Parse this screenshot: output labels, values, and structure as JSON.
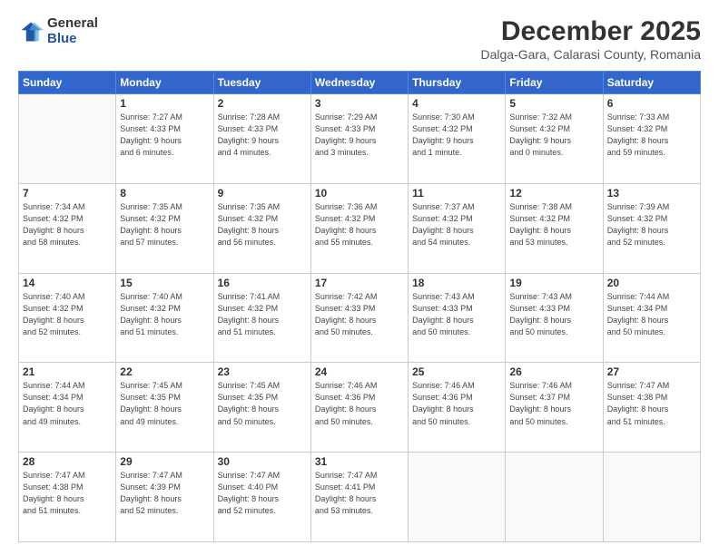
{
  "logo": {
    "general": "General",
    "blue": "Blue"
  },
  "header": {
    "title": "December 2025",
    "subtitle": "Dalga-Gara, Calarasi County, Romania"
  },
  "calendar": {
    "days_of_week": [
      "Sunday",
      "Monday",
      "Tuesday",
      "Wednesday",
      "Thursday",
      "Friday",
      "Saturday"
    ],
    "weeks": [
      [
        {
          "day": "",
          "info": ""
        },
        {
          "day": "1",
          "info": "Sunrise: 7:27 AM\nSunset: 4:33 PM\nDaylight: 9 hours\nand 6 minutes."
        },
        {
          "day": "2",
          "info": "Sunrise: 7:28 AM\nSunset: 4:33 PM\nDaylight: 9 hours\nand 4 minutes."
        },
        {
          "day": "3",
          "info": "Sunrise: 7:29 AM\nSunset: 4:33 PM\nDaylight: 9 hours\nand 3 minutes."
        },
        {
          "day": "4",
          "info": "Sunrise: 7:30 AM\nSunset: 4:32 PM\nDaylight: 9 hours\nand 1 minute."
        },
        {
          "day": "5",
          "info": "Sunrise: 7:32 AM\nSunset: 4:32 PM\nDaylight: 9 hours\nand 0 minutes."
        },
        {
          "day": "6",
          "info": "Sunrise: 7:33 AM\nSunset: 4:32 PM\nDaylight: 8 hours\nand 59 minutes."
        }
      ],
      [
        {
          "day": "7",
          "info": "Sunrise: 7:34 AM\nSunset: 4:32 PM\nDaylight: 8 hours\nand 58 minutes."
        },
        {
          "day": "8",
          "info": "Sunrise: 7:35 AM\nSunset: 4:32 PM\nDaylight: 8 hours\nand 57 minutes."
        },
        {
          "day": "9",
          "info": "Sunrise: 7:35 AM\nSunset: 4:32 PM\nDaylight: 8 hours\nand 56 minutes."
        },
        {
          "day": "10",
          "info": "Sunrise: 7:36 AM\nSunset: 4:32 PM\nDaylight: 8 hours\nand 55 minutes."
        },
        {
          "day": "11",
          "info": "Sunrise: 7:37 AM\nSunset: 4:32 PM\nDaylight: 8 hours\nand 54 minutes."
        },
        {
          "day": "12",
          "info": "Sunrise: 7:38 AM\nSunset: 4:32 PM\nDaylight: 8 hours\nand 53 minutes."
        },
        {
          "day": "13",
          "info": "Sunrise: 7:39 AM\nSunset: 4:32 PM\nDaylight: 8 hours\nand 52 minutes."
        }
      ],
      [
        {
          "day": "14",
          "info": "Sunrise: 7:40 AM\nSunset: 4:32 PM\nDaylight: 8 hours\nand 52 minutes."
        },
        {
          "day": "15",
          "info": "Sunrise: 7:40 AM\nSunset: 4:32 PM\nDaylight: 8 hours\nand 51 minutes."
        },
        {
          "day": "16",
          "info": "Sunrise: 7:41 AM\nSunset: 4:32 PM\nDaylight: 8 hours\nand 51 minutes."
        },
        {
          "day": "17",
          "info": "Sunrise: 7:42 AM\nSunset: 4:33 PM\nDaylight: 8 hours\nand 50 minutes."
        },
        {
          "day": "18",
          "info": "Sunrise: 7:43 AM\nSunset: 4:33 PM\nDaylight: 8 hours\nand 50 minutes."
        },
        {
          "day": "19",
          "info": "Sunrise: 7:43 AM\nSunset: 4:33 PM\nDaylight: 8 hours\nand 50 minutes."
        },
        {
          "day": "20",
          "info": "Sunrise: 7:44 AM\nSunset: 4:34 PM\nDaylight: 8 hours\nand 50 minutes."
        }
      ],
      [
        {
          "day": "21",
          "info": "Sunrise: 7:44 AM\nSunset: 4:34 PM\nDaylight: 8 hours\nand 49 minutes."
        },
        {
          "day": "22",
          "info": "Sunrise: 7:45 AM\nSunset: 4:35 PM\nDaylight: 8 hours\nand 49 minutes."
        },
        {
          "day": "23",
          "info": "Sunrise: 7:45 AM\nSunset: 4:35 PM\nDaylight: 8 hours\nand 50 minutes."
        },
        {
          "day": "24",
          "info": "Sunrise: 7:46 AM\nSunset: 4:36 PM\nDaylight: 8 hours\nand 50 minutes."
        },
        {
          "day": "25",
          "info": "Sunrise: 7:46 AM\nSunset: 4:36 PM\nDaylight: 8 hours\nand 50 minutes."
        },
        {
          "day": "26",
          "info": "Sunrise: 7:46 AM\nSunset: 4:37 PM\nDaylight: 8 hours\nand 50 minutes."
        },
        {
          "day": "27",
          "info": "Sunrise: 7:47 AM\nSunset: 4:38 PM\nDaylight: 8 hours\nand 51 minutes."
        }
      ],
      [
        {
          "day": "28",
          "info": "Sunrise: 7:47 AM\nSunset: 4:38 PM\nDaylight: 8 hours\nand 51 minutes."
        },
        {
          "day": "29",
          "info": "Sunrise: 7:47 AM\nSunset: 4:39 PM\nDaylight: 8 hours\nand 52 minutes."
        },
        {
          "day": "30",
          "info": "Sunrise: 7:47 AM\nSunset: 4:40 PM\nDaylight: 8 hours\nand 52 minutes."
        },
        {
          "day": "31",
          "info": "Sunrise: 7:47 AM\nSunset: 4:41 PM\nDaylight: 8 hours\nand 53 minutes."
        },
        {
          "day": "",
          "info": ""
        },
        {
          "day": "",
          "info": ""
        },
        {
          "day": "",
          "info": ""
        }
      ]
    ]
  }
}
